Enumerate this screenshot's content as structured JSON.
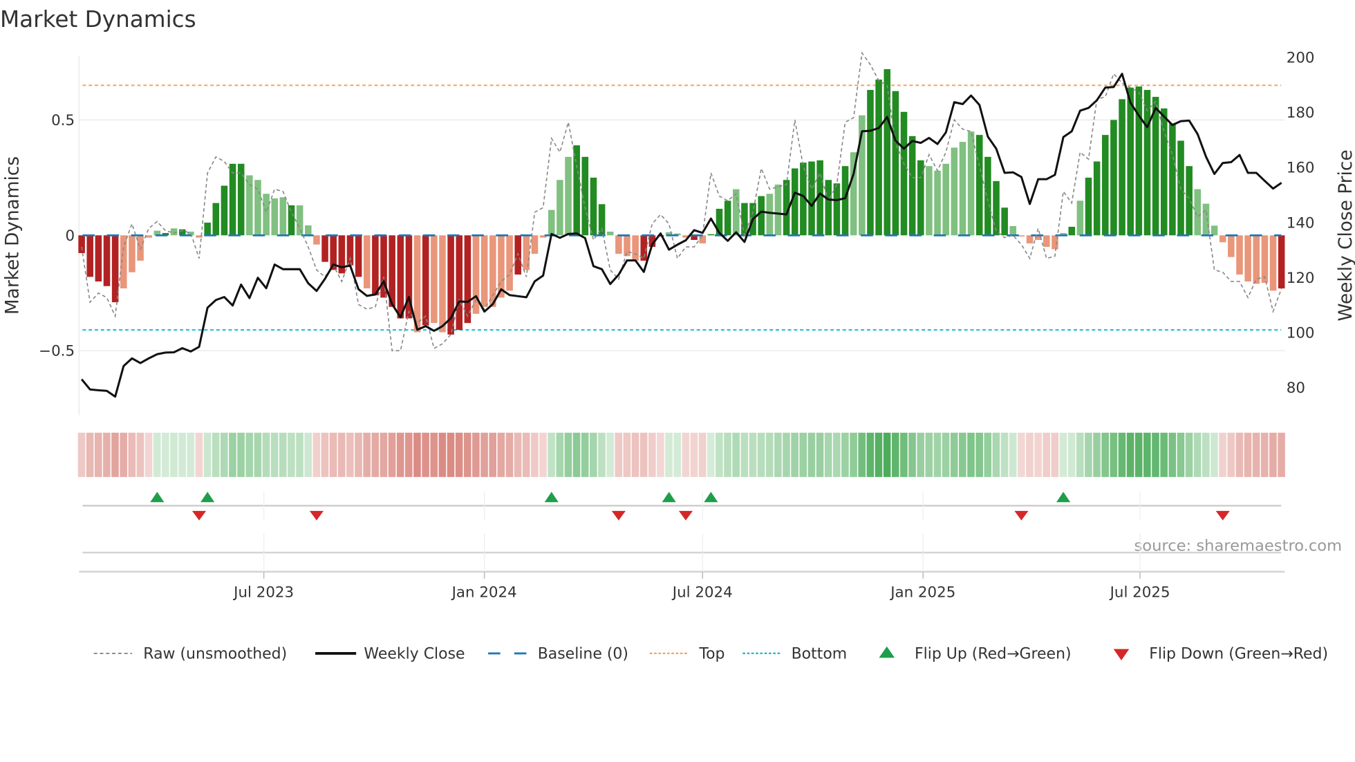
{
  "title": "Market Dynamics",
  "source": "source: sharemaestro.com",
  "chart_data": {
    "type": "bar",
    "title": "Market Dynamics",
    "ylabel_left": "Market Dynamics",
    "ylabel_right": "Weekly Close Price",
    "frequency": "weekly",
    "start_date": "2023-01-30",
    "ylim_left": [
      -0.78,
      0.775
    ],
    "ylim_right": [
      69.6,
      200
    ],
    "yticks_left": [
      {
        "v": 0.5,
        "label": "0.5"
      },
      {
        "v": 0,
        "label": "0"
      },
      {
        "v": -0.5,
        "label": "−0.5"
      }
    ],
    "yticks_right": [
      200,
      180,
      160,
      140,
      120,
      100,
      80
    ],
    "xticks": [
      {
        "date": "2023-07-01",
        "label": "Jul 2023"
      },
      {
        "date": "2024-01-01",
        "label": "Jan 2024"
      },
      {
        "date": "2024-07-01",
        "label": "Jul 2024"
      },
      {
        "date": "2025-01-01",
        "label": "Jan 2025"
      },
      {
        "date": "2025-07-01",
        "label": "Jul 2025"
      }
    ],
    "top_level": 0.65,
    "bottom_level": -0.41,
    "baseline": 0,
    "momentum": [
      -0.077,
      -0.18,
      -0.2,
      -0.22,
      -0.29,
      -0.23,
      -0.16,
      -0.11,
      -0.01,
      0.02,
      0.01,
      0.03,
      0.026,
      0.016,
      -0.01,
      0.055,
      0.14,
      0.215,
      0.31,
      0.31,
      0.26,
      0.24,
      0.18,
      0.16,
      0.165,
      0.13,
      0.13,
      0.043,
      -0.04,
      -0.115,
      -0.15,
      -0.165,
      -0.13,
      -0.18,
      -0.23,
      -0.26,
      -0.27,
      -0.31,
      -0.36,
      -0.36,
      -0.42,
      -0.39,
      -0.38,
      -0.42,
      -0.43,
      -0.41,
      -0.38,
      -0.34,
      -0.31,
      -0.31,
      -0.27,
      -0.24,
      -0.17,
      -0.15,
      -0.08,
      -0.01,
      0.11,
      0.24,
      0.34,
      0.39,
      0.34,
      0.25,
      0.135,
      0.016,
      -0.08,
      -0.09,
      -0.11,
      -0.11,
      -0.05,
      -0.005,
      0.013,
      0.008,
      -0.01,
      -0.02,
      -0.035,
      0.005,
      0.115,
      0.15,
      0.2,
      0.14,
      0.14,
      0.17,
      0.18,
      0.22,
      0.24,
      0.29,
      0.315,
      0.32,
      0.325,
      0.24,
      0.225,
      0.3,
      0.36,
      0.52,
      0.63,
      0.675,
      0.72,
      0.625,
      0.535,
      0.43,
      0.325,
      0.3,
      0.28,
      0.31,
      0.38,
      0.405,
      0.45,
      0.435,
      0.34,
      0.235,
      0.12,
      0.04,
      -0.005,
      -0.035,
      -0.02,
      -0.05,
      -0.06,
      0.01,
      0.037,
      0.15,
      0.25,
      0.32,
      0.435,
      0.5,
      0.59,
      0.64,
      0.645,
      0.63,
      0.6,
      0.55,
      0.485,
      0.41,
      0.3,
      0.2,
      0.137,
      0.042,
      -0.03,
      -0.094,
      -0.17,
      -0.2,
      -0.21,
      -0.206,
      -0.24,
      -0.23
    ],
    "strengthening": "dddddllllldldlldddddllllldllldddddldddddldlldddllllldllllllddddlllldddllldldddldddllddddddddlldddddddllllllddddllllllldldddddddddddddlllllllllldddddldl",
    "raw": [
      -0.05,
      -0.29,
      -0.25,
      -0.27,
      -0.35,
      -0.05,
      0.05,
      -0.06,
      0.03,
      0.06,
      0.02,
      0.01,
      0.02,
      0.01,
      -0.1,
      0.27,
      0.34,
      0.32,
      0.27,
      0.27,
      0.22,
      0.2,
      0.1,
      0.2,
      0.19,
      0.1,
      0.03,
      -0.05,
      -0.15,
      -0.18,
      -0.13,
      -0.2,
      -0.1,
      -0.3,
      -0.32,
      -0.31,
      -0.18,
      -0.5,
      -0.5,
      -0.33,
      -0.38,
      -0.35,
      -0.49,
      -0.47,
      -0.43,
      -0.28,
      -0.35,
      -0.28,
      -0.32,
      -0.26,
      -0.2,
      -0.17,
      -0.08,
      -0.18,
      0.1,
      0.12,
      0.42,
      0.36,
      0.49,
      0.3,
      0.12,
      -0.02,
      0.03,
      -0.15,
      -0.19,
      -0.07,
      -0.08,
      -0.1,
      0.05,
      0.09,
      0.05,
      -0.1,
      -0.05,
      -0.05,
      0.0,
      0.27,
      0.17,
      0.15,
      0.18,
      0.0,
      0.1,
      0.29,
      0.2,
      0.21,
      0.22,
      0.5,
      0.3,
      0.2,
      0.27,
      0.15,
      0.22,
      0.49,
      0.51,
      0.79,
      0.74,
      0.67,
      0.65,
      0.4,
      0.31,
      0.25,
      0.25,
      0.35,
      0.28,
      0.36,
      0.5,
      0.46,
      0.45,
      0.3,
      0.15,
      0.02,
      -0.01,
      0.0,
      -0.04,
      -0.1,
      0.03,
      -0.1,
      -0.09,
      0.19,
      0.14,
      0.36,
      0.33,
      0.59,
      0.6,
      0.7,
      0.66,
      0.64,
      0.62,
      0.54,
      0.58,
      0.45,
      0.35,
      0.2,
      0.16,
      0.08,
      0.11,
      -0.15,
      -0.16,
      -0.2,
      -0.2,
      -0.27,
      -0.19,
      -0.18,
      -0.33,
      -0.23
    ],
    "close": [
      82.7,
      79,
      78.7,
      78.5,
      76.4,
      87.5,
      90.3,
      88.6,
      90.3,
      91.8,
      92.4,
      92.5,
      94,
      92.8,
      94.5,
      108.7,
      111.5,
      112.6,
      109.5,
      117.1,
      112.2,
      119.6,
      115.8,
      124.4,
      122.7,
      122.7,
      122.7,
      117.6,
      114.8,
      119.2,
      124.4,
      123.4,
      124,
      115.4,
      113,
      113.5,
      118.3,
      110,
      105.2,
      112.6,
      100.7,
      102,
      100.3,
      102,
      104.9,
      111,
      110.8,
      112.9,
      107.3,
      110,
      115.4,
      113.3,
      112.9,
      112.5,
      118.3,
      120.4,
      135.5,
      134.1,
      135.5,
      135.7,
      134,
      123.8,
      122.7,
      117.3,
      120.7,
      125.9,
      125.9,
      121.7,
      131.7,
      135.7,
      129.8,
      131.6,
      133.2,
      136.9,
      135.9,
      141.1,
      135.9,
      133,
      136.1,
      132.6,
      140.9,
      143.6,
      143.2,
      142.9,
      142.6,
      150.5,
      149.3,
      145.7,
      150.2,
      148,
      147.8,
      148.5,
      157.3,
      172.8,
      173,
      174,
      178,
      169.4,
      166.5,
      169.3,
      168.6,
      170.4,
      168.2,
      172.4,
      183.4,
      182.7,
      185.8,
      182.4,
      170.9,
      166.5,
      157.7,
      157.9,
      156.2,
      146.4,
      155.4,
      155.4,
      157,
      170.7,
      172.8,
      180.3,
      181.3,
      184.1,
      188.7,
      188.9,
      193.7,
      183.2,
      178.5,
      174.3,
      181.3,
      178.2,
      175.1,
      176.5,
      176.7,
      171.8,
      163.6,
      157.3,
      161.3,
      161.6,
      164.2,
      157.7,
      157.7,
      154.8,
      152,
      154.1
    ],
    "flip_up_weeks": [
      10,
      16,
      57,
      71,
      76,
      118
    ],
    "flip_down_weeks": [
      15,
      29,
      65,
      73,
      113,
      137
    ],
    "legend": [
      {
        "label": "Raw (unsmoothed)",
        "kind": "raw"
      },
      {
        "label": "Weekly Close",
        "kind": "close"
      },
      {
        "label": "Baseline (0)",
        "kind": "baseline"
      },
      {
        "label": "Top",
        "kind": "top"
      },
      {
        "label": "Bottom",
        "kind": "bottom"
      },
      {
        "label": "Flip Up (Red→Green)",
        "kind": "flip-up"
      },
      {
        "label": "Flip Down (Green→Red)",
        "kind": "flip-down"
      }
    ],
    "colors": {
      "pos_strong": "#228b22",
      "pos_weak": "#80c080",
      "neg_strong": "#b22222",
      "neg_weak": "#e9967a",
      "close": "#111111",
      "raw": "#888888",
      "baseline": "#1f77b4",
      "top": "#f4a460",
      "bottom": "#17becf",
      "flip_up": "#1e9e4a",
      "flip_down": "#d62728"
    },
    "legend_position": "bottom"
  }
}
